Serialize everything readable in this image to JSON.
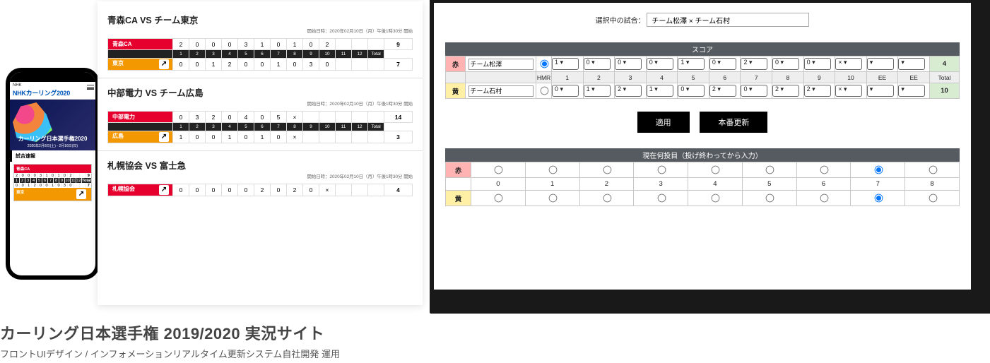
{
  "phone": {
    "nhk_small": "NHK",
    "logo": "NHKカーリング2020",
    "menu_label": "MENU",
    "hero_title": "カーリング日本選手権2020",
    "hero_dates": "2020年2月8日(土) - 2月16日(日)",
    "section": "試合速報",
    "mini": {
      "team_a": "青森CA",
      "team_b": "東京",
      "a_scores": [
        "2",
        "0",
        "0",
        "0",
        "3",
        "1",
        "0",
        "1",
        "0",
        "2"
      ],
      "b_scores": [
        "0",
        "0",
        "1",
        "2",
        "0",
        "0",
        "1",
        "0",
        "3",
        "0"
      ],
      "ends": [
        "1",
        "2",
        "3",
        "4",
        "5",
        "6",
        "7",
        "8",
        "9",
        "10",
        "11",
        "12",
        "Total"
      ],
      "a_total": "9",
      "b_total": "7"
    }
  },
  "desk": {
    "games": [
      {
        "title": "青森CA VS チーム東京",
        "date": "開始日時：2020年02月10日（月）午後1時30分 開始",
        "team_a": "青森CA",
        "team_b": "東京",
        "a": [
          "2",
          "0",
          "0",
          "0",
          "3",
          "1",
          "0",
          "1",
          "0",
          "2",
          "",
          "",
          ""
        ],
        "b": [
          "0",
          "0",
          "1",
          "2",
          "0",
          "0",
          "1",
          "0",
          "3",
          "0",
          "",
          "",
          ""
        ],
        "ends": [
          "1",
          "2",
          "3",
          "4",
          "5",
          "6",
          "7",
          "8",
          "9",
          "10",
          "11",
          "12",
          "Total"
        ],
        "a_total": "9",
        "b_total": "7"
      },
      {
        "title": "中部電力 VS チーム広島",
        "date": "開始日時：2020年02月10日（月）午後1時30分 開始",
        "team_a": "中部電力",
        "team_b": "広島",
        "a": [
          "0",
          "3",
          "2",
          "0",
          "4",
          "0",
          "5",
          "×",
          "",
          "",
          "",
          "",
          ""
        ],
        "b": [
          "1",
          "0",
          "0",
          "1",
          "0",
          "1",
          "0",
          "×",
          "",
          "",
          "",
          "",
          ""
        ],
        "ends": [
          "1",
          "2",
          "3",
          "4",
          "5",
          "6",
          "7",
          "8",
          "9",
          "10",
          "11",
          "12",
          "Total"
        ],
        "a_total": "14",
        "b_total": "3"
      },
      {
        "title": "札幌協会 VS 富士急",
        "date": "開始日時：2020年02月10日（月）午後1時30分 開始",
        "team_a": "札幌協会",
        "team_b": "",
        "a": [
          "0",
          "0",
          "0",
          "0",
          "0",
          "2",
          "0",
          "2",
          "0",
          "×",
          "",
          "",
          ""
        ],
        "b": [],
        "ends": [],
        "a_total": "4",
        "b_total": ""
      }
    ]
  },
  "admin": {
    "selected_label": "選択中の試合：",
    "selected_value": "チーム松澤 × チーム石村",
    "score_header": "スコア",
    "red_label": "赤",
    "yellow_label": "黄",
    "hmr_label": "HMR",
    "team_red": "チーム松澤",
    "team_yellow": "チーム石村",
    "red_scores": [
      "1",
      "0",
      "0",
      "0",
      "1",
      "0",
      "2",
      "0",
      "0",
      "×",
      "",
      ""
    ],
    "yellow_scores": [
      "0",
      "1",
      "2",
      "1",
      "0",
      "2",
      "0",
      "2",
      "2",
      "×",
      "",
      ""
    ],
    "end_labels": [
      "1",
      "2",
      "3",
      "4",
      "5",
      "6",
      "7",
      "8",
      "9",
      "10",
      "EE",
      "EE",
      "Total"
    ],
    "red_total": "4",
    "yellow_total": "10",
    "btn_apply": "適用",
    "btn_publish": "本番更新",
    "throw_header": "現在何投目（投げ終わってから入力）",
    "throw_nums": [
      "0",
      "1",
      "2",
      "3",
      "4",
      "5",
      "6",
      "7",
      "8"
    ],
    "red_selected_throw": 7,
    "yellow_selected_throw": 7
  },
  "caption": {
    "title": "カーリング日本選手権 2019/2020 実況サイト",
    "sub": "フロントUIデザイン / インフォメーションリアルタイム更新システム自社開発 運用"
  }
}
